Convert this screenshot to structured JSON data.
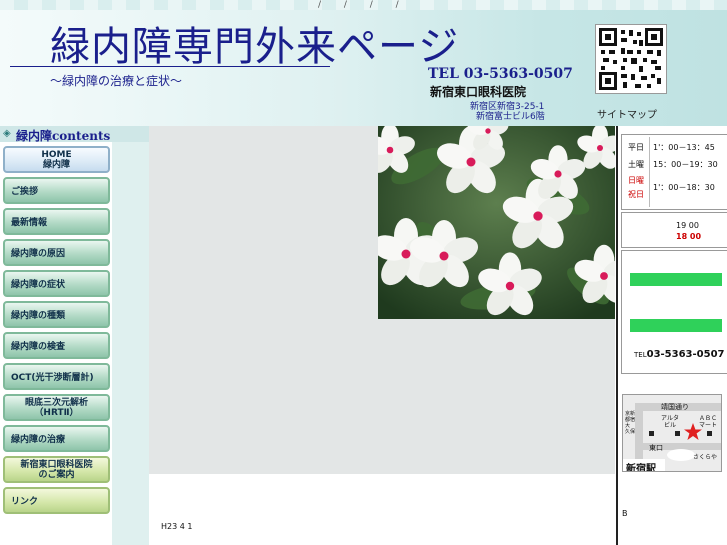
{
  "header": {
    "top_marks": "/ / / /",
    "title": "緑内障専門外来ページ",
    "subtitle": "～緑内障の治療と症状～",
    "tel": "TEL 03-5363-0507",
    "clinic_name": "新宿東口眼科医院",
    "address_line1": "新宿区新宿3-25-1",
    "address_line2": "新宿富士ビル6階",
    "sitemap": "サイトマップ"
  },
  "sidebar": {
    "heading": "緑内障contents",
    "items": [
      {
        "label": "HOME\n緑内障"
      },
      {
        "label": "ご挨拶"
      },
      {
        "label": "最新情報"
      },
      {
        "label": "緑内障の原因"
      },
      {
        "label": "緑内障の症状"
      },
      {
        "label": "緑内障の種類"
      },
      {
        "label": "緑内障の検査"
      },
      {
        "label": "OCT(光干渉断層計)"
      },
      {
        "label": "眼底三次元解析\n（HRTⅡ）"
      },
      {
        "label": "緑内障の治療"
      },
      {
        "label": "新宿東口眼科医院\nのご案内"
      },
      {
        "label": "リンク"
      }
    ]
  },
  "main": {
    "date_text": "H23 4 1"
  },
  "right": {
    "hours": [
      {
        "day": "平日",
        "time": "1'：00－13：45",
        "color": "#111111"
      },
      {
        "day": "土曜",
        "time": "15：00－19：30",
        "color": "#111111"
      },
      {
        "day": "日曜",
        "time": "",
        "color": "#cc0000"
      },
      {
        "day": "祝日",
        "time": "1'：00－18：30",
        "color": "#cc0000"
      }
    ],
    "close_time_1": "19 00",
    "close_time_2": "18 00",
    "tel_prefix": "TEL",
    "tel_number": "03-5363-0507",
    "map": {
      "street": "靖国通り",
      "bldg1": "アルタ\nビル",
      "bldg2": "ＡＢＣ\nマート",
      "avenue": "京新\n都宿\n大\n久保",
      "exit": "東口",
      "store": "さくらや",
      "station": "新宿駅"
    },
    "bottom_letter": "B"
  },
  "colors": {
    "title_blue": "#1a1f8c",
    "nav_green": "#8ec4aa",
    "accent_green": "#2fd15a",
    "holiday_red": "#cc0000",
    "star_red": "#e02020"
  }
}
